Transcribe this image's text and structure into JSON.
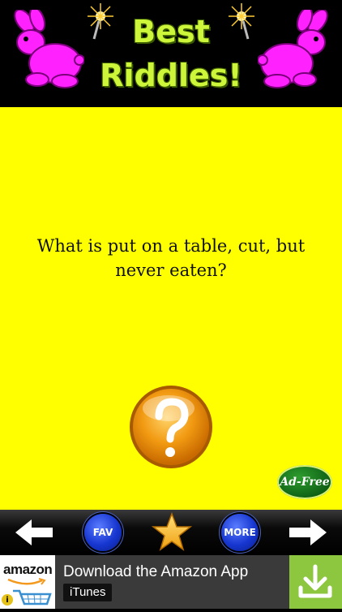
{
  "header": {
    "title_line1": "Best",
    "title_line2": "Riddles!"
  },
  "riddle": {
    "text": "What is put on a table, cut, but never eaten?"
  },
  "buttons": {
    "adfree_label": "Ad-Free",
    "fav_label": "FAV",
    "more_label": "MORE"
  },
  "ad": {
    "logo_text": "amazon",
    "headline": "Download the Amazon App",
    "store": "iTunes",
    "info_glyph": "i"
  },
  "colors": {
    "background": "#ffff00",
    "title": "#cdf53a",
    "bunny": "#ff22ff",
    "nav_button": "#1636d0",
    "answer_button": "#f29a12",
    "download": "#8dc63f"
  },
  "icons": {
    "bunny": "bunny-icon",
    "sparkle": "sparkle-icon",
    "answer": "question-mark-icon",
    "prev": "arrow-left-icon",
    "next": "arrow-right-icon",
    "favorite": "star-icon",
    "download": "download-icon"
  }
}
